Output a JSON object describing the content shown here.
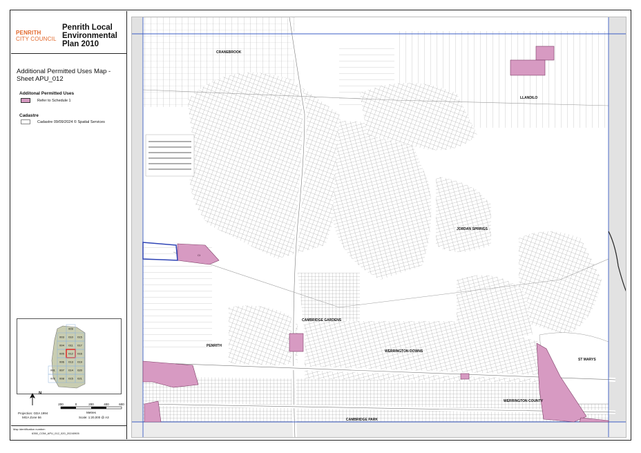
{
  "council": {
    "line1": "PENRITH",
    "line2": "CITY COUNCIL"
  },
  "plan_title": "Penrith Local Environmental Plan 2010",
  "sheet_title": "Additional Permitted Uses Map - Sheet APU_012",
  "legend": {
    "apu_heading": "Additonal Permitted Uses",
    "apu_item": "Refer to Schedule 1",
    "cadastre_heading": "Cadastre",
    "cadastre_item": "Cadastre 09/09/2024 © Spatial Services"
  },
  "colors": {
    "apu_fill": "#d79ac2",
    "apu_stroke": "#7b3a63",
    "brand": "#e2672a",
    "sheet_highlight": "#e01d1d",
    "boundary": "#3b5cc4",
    "keymap_fill": "#c9cdb1"
  },
  "keymap": {
    "top": "009",
    "rows": [
      [
        "003",
        "010",
        "015"
      ],
      [
        "004",
        "011",
        "017"
      ],
      [
        "005",
        "012",
        "016"
      ],
      [
        "006",
        "013",
        "019"
      ],
      [
        "007",
        "014",
        "020"
      ],
      [
        "008",
        "015",
        "021"
      ]
    ],
    "left_extra": [
      "001",
      "002"
    ],
    "current": "012"
  },
  "north_arrow": "N",
  "projection": [
    "Projection: GDA 1994",
    "MGA Zone 56"
  ],
  "scale": {
    "ticks": [
      "200",
      "0",
      "200",
      "400",
      "600"
    ],
    "unit": "Metres",
    "ratio": "Scale: 1:20,000 @ A3"
  },
  "identification": {
    "label": "Map identification number:",
    "value": "6350_COM_APU_012_020_20240905"
  },
  "map_labels": {
    "cranebrook": "CRANEBROOK",
    "llandilo": "LLANDILO",
    "jordan_springs": "JORDAN SPRINGS",
    "cambridge_gardens": "CAMBRIDGE GARDENS",
    "penrith": "PENRITH",
    "werrington_downs": "WERRINGTON DOWNS",
    "st_marys": "ST MARYS",
    "werrington_county": "WERRINGTON COUNTY",
    "cambridge_park": "CAMBRIDGE PARK",
    "apu_label": "Ct"
  }
}
